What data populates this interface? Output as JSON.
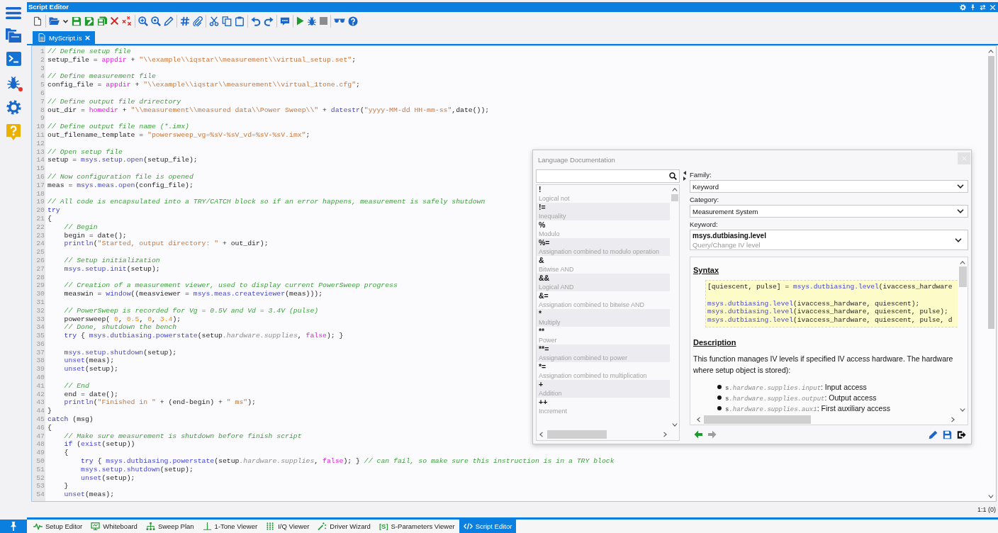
{
  "sidebar": [
    {
      "kind": "menu",
      "alert": false
    },
    {
      "kind": "folders",
      "alert": false
    },
    {
      "kind": "terminal",
      "alert": false
    },
    {
      "kind": "debug",
      "alert": true
    },
    {
      "kind": "settings",
      "alert": false
    },
    {
      "kind": "help",
      "alert": false
    }
  ],
  "window": {
    "title": "Script Editor",
    "controls": [
      {
        "kind": "settings"
      },
      {
        "kind": "pin"
      },
      {
        "kind": "swap"
      },
      {
        "kind": "close"
      }
    ]
  },
  "toolbar": [
    {
      "kind": "new"
    },
    {
      "kind": "separator"
    },
    {
      "kind": "open"
    },
    {
      "kind": "dropdown"
    },
    {
      "kind": "save"
    },
    {
      "kind": "save_as"
    },
    {
      "kind": "save_all"
    },
    {
      "kind": "delete"
    },
    {
      "kind": "delete_all"
    },
    {
      "kind": "separator"
    },
    {
      "kind": "zoom_in"
    },
    {
      "kind": "zoom_fit"
    },
    {
      "kind": "edit"
    },
    {
      "kind": "separator"
    },
    {
      "kind": "hash"
    },
    {
      "kind": "attach"
    },
    {
      "kind": "separator"
    },
    {
      "kind": "cut"
    },
    {
      "kind": "copy"
    },
    {
      "kind": "paste"
    },
    {
      "kind": "separator"
    },
    {
      "kind": "undo"
    },
    {
      "kind": "redo"
    },
    {
      "kind": "separator"
    },
    {
      "kind": "comment"
    },
    {
      "kind": "separator"
    },
    {
      "kind": "run"
    },
    {
      "kind": "debug"
    },
    {
      "kind": "stop"
    },
    {
      "kind": "separator"
    },
    {
      "kind": "glasses"
    },
    {
      "kind": "help"
    }
  ],
  "tabs": [
    {
      "label": "MyScript.is",
      "selected": true
    }
  ],
  "editor": {
    "lines": [
      {
        "number": "1",
        "tokens": [
          {
            "kind": "comment",
            "text": "// Define setup file"
          }
        ]
      },
      {
        "number": "2",
        "tokens": [
          {
            "kind": "plain",
            "text": "setup_file = "
          },
          {
            "kind": "builtin",
            "text": "appdir"
          },
          {
            "kind": "plain",
            "text": " + "
          },
          {
            "kind": "string",
            "text": "\"\\\\example\\\\iqstar\\\\measurement\\\\virtual_setup.set\""
          },
          {
            "kind": "plain",
            "text": ";"
          }
        ]
      },
      {
        "number": "3"
      },
      {
        "number": "4",
        "tokens": [
          {
            "kind": "comment",
            "text": "// Define measurement file"
          }
        ]
      },
      {
        "number": "5",
        "tokens": [
          {
            "kind": "plain",
            "text": "config_file = "
          },
          {
            "kind": "builtin",
            "text": "appdir"
          },
          {
            "kind": "plain",
            "text": " + "
          },
          {
            "kind": "string",
            "text": "\"\\\\example\\\\iqstar\\\\measurement\\\\virtual_1tone.cfg\""
          },
          {
            "kind": "plain",
            "text": ";"
          }
        ]
      },
      {
        "number": "6"
      },
      {
        "number": "7",
        "tokens": [
          {
            "kind": "comment",
            "text": "// Define output file drirectory"
          }
        ]
      },
      {
        "number": "8",
        "tokens": [
          {
            "kind": "plain",
            "text": "out_dir = "
          },
          {
            "kind": "builtin",
            "text": "homedir"
          },
          {
            "kind": "plain",
            "text": " + "
          },
          {
            "kind": "string",
            "text": "\"\\\\measurement\\\\measured data\\\\Power Sweep\\\\\""
          },
          {
            "kind": "plain",
            "text": " + "
          },
          {
            "kind": "function",
            "text": "datestr"
          },
          {
            "kind": "plain",
            "text": "("
          },
          {
            "kind": "string",
            "text": "\"yyyy-MM-dd HH-mm-ss\""
          },
          {
            "kind": "plain",
            "text": ",date());"
          }
        ]
      },
      {
        "number": "9"
      },
      {
        "number": "10",
        "tokens": [
          {
            "kind": "comment",
            "text": "// Define output file name (*.imx)"
          }
        ]
      },
      {
        "number": "11",
        "tokens": [
          {
            "kind": "plain",
            "text": "out_filename_template = "
          },
          {
            "kind": "string",
            "text": "\"powersweep_vg=%sV-%sV_vd=%sV-%sV.imx\""
          },
          {
            "kind": "plain",
            "text": ";"
          }
        ]
      },
      {
        "number": "12"
      },
      {
        "number": "13",
        "tokens": [
          {
            "kind": "comment",
            "text": "// Open setup file"
          }
        ]
      },
      {
        "number": "14",
        "tokens": [
          {
            "kind": "plain",
            "text": "setup = "
          },
          {
            "kind": "function",
            "text": "msys.setup.open"
          },
          {
            "kind": "plain",
            "text": "(setup_file);"
          }
        ]
      },
      {
        "number": "15"
      },
      {
        "number": "16",
        "tokens": [
          {
            "kind": "comment",
            "text": "// Now configuration file is opened"
          }
        ]
      },
      {
        "number": "17",
        "tokens": [
          {
            "kind": "plain",
            "text": "meas = "
          },
          {
            "kind": "function",
            "text": "msys.meas.open"
          },
          {
            "kind": "plain",
            "text": "(config_file);"
          }
        ]
      },
      {
        "number": "18"
      },
      {
        "number": "19",
        "tokens": [
          {
            "kind": "comment",
            "text": "// All code is encapsulated into a TRY/CATCH block so if an error happens, measurement is safely shutdown"
          }
        ]
      },
      {
        "number": "20",
        "tokens": [
          {
            "kind": "keyword",
            "text": "try"
          }
        ]
      },
      {
        "number": "21",
        "tokens": [
          {
            "kind": "plain",
            "text": "{"
          }
        ]
      },
      {
        "number": "22",
        "tokens": [
          {
            "kind": "comment",
            "text": "    // Begin"
          }
        ]
      },
      {
        "number": "23",
        "tokens": [
          {
            "kind": "plain",
            "text": "    begin = date();"
          }
        ]
      },
      {
        "number": "24",
        "tokens": [
          {
            "kind": "function",
            "text": "    println"
          },
          {
            "kind": "plain",
            "text": "("
          },
          {
            "kind": "string",
            "text": "\"Started, output directory: \""
          },
          {
            "kind": "plain",
            "text": " + out_dir);"
          }
        ]
      },
      {
        "number": "25"
      },
      {
        "number": "26",
        "tokens": [
          {
            "kind": "comment",
            "text": "    // Setup initialization"
          }
        ]
      },
      {
        "number": "27",
        "tokens": [
          {
            "kind": "function",
            "text": "    msys.setup.init"
          },
          {
            "kind": "plain",
            "text": "(setup);"
          }
        ]
      },
      {
        "number": "28"
      },
      {
        "number": "29",
        "tokens": [
          {
            "kind": "comment",
            "text": "    // Creation of a measurement viewer, used to display current PowerSweep progress"
          }
        ]
      },
      {
        "number": "30",
        "tokens": [
          {
            "kind": "plain",
            "text": "    measwin = "
          },
          {
            "kind": "function",
            "text": "window"
          },
          {
            "kind": "plain",
            "text": "((measviewer = "
          },
          {
            "kind": "function",
            "text": "msys.meas.createviewer"
          },
          {
            "kind": "plain",
            "text": "(meas)));"
          }
        ]
      },
      {
        "number": "31"
      },
      {
        "number": "32",
        "tokens": [
          {
            "kind": "comment",
            "text": "    // PowerSweep is recorded for Vg = 0.5V and Vd = 3.4V (pulse)"
          }
        ]
      },
      {
        "number": "33",
        "tokens": [
          {
            "kind": "plain",
            "text": "    powersweep( "
          },
          {
            "kind": "number",
            "text": "0"
          },
          {
            "kind": "plain",
            "text": ", "
          },
          {
            "kind": "number",
            "text": "0.5"
          },
          {
            "kind": "plain",
            "text": ", "
          },
          {
            "kind": "number",
            "text": "0"
          },
          {
            "kind": "plain",
            "text": ", "
          },
          {
            "kind": "number",
            "text": "3.4"
          },
          {
            "kind": "plain",
            "text": ");"
          }
        ]
      },
      {
        "number": "34",
        "tokens": [
          {
            "kind": "comment",
            "text": "    // Done, shutdown the bench"
          }
        ]
      },
      {
        "number": "35",
        "tokens": [
          {
            "kind": "keyword",
            "text": "    try"
          },
          {
            "kind": "plain",
            "text": " { "
          },
          {
            "kind": "function",
            "text": "msys.dutbiasing.powerstate"
          },
          {
            "kind": "plain",
            "text": "(setup"
          },
          {
            "kind": "member",
            "text": ".hardware.supplies"
          },
          {
            "kind": "plain",
            "text": ", "
          },
          {
            "kind": "builtin",
            "text": "false"
          },
          {
            "kind": "plain",
            "text": "); }"
          }
        ]
      },
      {
        "number": "36"
      },
      {
        "number": "37",
        "tokens": [
          {
            "kind": "function",
            "text": "    msys.setup.shutdown"
          },
          {
            "kind": "plain",
            "text": "(setup);"
          }
        ]
      },
      {
        "number": "38",
        "tokens": [
          {
            "kind": "function",
            "text": "    unset"
          },
          {
            "kind": "plain",
            "text": "(meas);"
          }
        ]
      },
      {
        "number": "39",
        "tokens": [
          {
            "kind": "function",
            "text": "    unset"
          },
          {
            "kind": "plain",
            "text": "(setup);"
          }
        ]
      },
      {
        "number": "40"
      },
      {
        "number": "41",
        "tokens": [
          {
            "kind": "comment",
            "text": "    // End"
          }
        ]
      },
      {
        "number": "42",
        "tokens": [
          {
            "kind": "plain",
            "text": "    end = date();"
          }
        ]
      },
      {
        "number": "43",
        "tokens": [
          {
            "kind": "function",
            "text": "    println"
          },
          {
            "kind": "plain",
            "text": "("
          },
          {
            "kind": "string",
            "text": "\"Finished in \""
          },
          {
            "kind": "plain",
            "text": " + (end-begin) + "
          },
          {
            "kind": "string",
            "text": "\" ms\""
          },
          {
            "kind": "plain",
            "text": ");"
          }
        ]
      },
      {
        "number": "44",
        "tokens": [
          {
            "kind": "plain",
            "text": "}"
          }
        ]
      },
      {
        "number": "45",
        "tokens": [
          {
            "kind": "keyword",
            "text": "catch"
          },
          {
            "kind": "plain",
            "text": " (msg)"
          }
        ]
      },
      {
        "number": "46",
        "tokens": [
          {
            "kind": "plain",
            "text": "{"
          }
        ]
      },
      {
        "number": "47",
        "tokens": [
          {
            "kind": "comment",
            "text": "    // Make sure measurement is shutdown before finish script"
          }
        ]
      },
      {
        "number": "48",
        "tokens": [
          {
            "kind": "keyword",
            "text": "    if"
          },
          {
            "kind": "plain",
            "text": " ("
          },
          {
            "kind": "function",
            "text": "exist"
          },
          {
            "kind": "plain",
            "text": "(setup))"
          }
        ]
      },
      {
        "number": "49",
        "tokens": [
          {
            "kind": "plain",
            "text": "    {"
          }
        ]
      },
      {
        "number": "50",
        "tokens": [
          {
            "kind": "keyword",
            "text": "        try"
          },
          {
            "kind": "plain",
            "text": " { "
          },
          {
            "kind": "function",
            "text": "msys.dutbiasing.powerstate"
          },
          {
            "kind": "plain",
            "text": "(setup"
          },
          {
            "kind": "member",
            "text": ".hardware.supplies"
          },
          {
            "kind": "plain",
            "text": ", "
          },
          {
            "kind": "builtin",
            "text": "false"
          },
          {
            "kind": "plain",
            "text": "); } "
          },
          {
            "kind": "comment",
            "text": "// can fail, so make sure this instruction is in a TRY block"
          }
        ]
      },
      {
        "number": "51",
        "tokens": [
          {
            "kind": "function",
            "text": "        msys.setup.shutdown"
          },
          {
            "kind": "plain",
            "text": "(setup);"
          }
        ]
      },
      {
        "number": "52",
        "tokens": [
          {
            "kind": "function",
            "text": "        unset"
          },
          {
            "kind": "plain",
            "text": "(setup);"
          }
        ]
      },
      {
        "number": "53",
        "tokens": [
          {
            "kind": "plain",
            "text": "    }"
          }
        ]
      },
      {
        "number": "54",
        "tokens": [
          {
            "kind": "function",
            "text": "    unset"
          },
          {
            "kind": "plain",
            "text": "(meas);"
          }
        ]
      }
    ]
  },
  "documentation": {
    "title": "Language Documentation",
    "entries": [
      {
        "symbol": "!",
        "description": "Logical not"
      },
      {
        "symbol": "!=",
        "description": "Inequality"
      },
      {
        "symbol": "%",
        "description": "Modulo"
      },
      {
        "symbol": "%=",
        "description": "Assignation combined to modulo operation"
      },
      {
        "symbol": "&",
        "description": "Bitwise AND"
      },
      {
        "symbol": "&&",
        "description": "Logical AND"
      },
      {
        "symbol": "&=",
        "description": "Assignation combined to bitwise AND"
      },
      {
        "symbol": "*",
        "description": "Multiply"
      },
      {
        "symbol": "**",
        "description": "Power"
      },
      {
        "symbol": "**=",
        "description": "Assignation combined to power"
      },
      {
        "symbol": "*=",
        "description": "Assignation combined to multiplication"
      },
      {
        "symbol": "+",
        "description": "Addition"
      },
      {
        "symbol": "++",
        "description": "Increment"
      }
    ],
    "fields": [
      {
        "label": "Family:",
        "value": "Keyword"
      },
      {
        "label": "Category:",
        "value": "Measurement System"
      }
    ],
    "keyword": {
      "label": "Keyword:",
      "name": "msys.dutbiasing.level",
      "summary": "Query/Change IV level"
    },
    "syntax": {
      "heading": "Syntax",
      "lines": [
        {
          "kind": "code",
          "tokens": [
            {
              "kind": "plain",
              "text": "[quiescent, pulse] = "
            },
            {
              "kind": "function",
              "text": "msys.dutbiasing.level"
            },
            {
              "kind": "plain",
              "text": "(ivaccess_hardware"
            }
          ]
        },
        {
          "kind": "blank"
        },
        {
          "kind": "code",
          "tokens": [
            {
              "kind": "function",
              "text": "msys.dutbiasing.level"
            },
            {
              "kind": "plain",
              "text": "(ivaccess_hardware, quiescent);"
            }
          ]
        },
        {
          "kind": "code",
          "tokens": [
            {
              "kind": "function",
              "text": "msys.dutbiasing.level"
            },
            {
              "kind": "plain",
              "text": "(ivaccess_hardware, quiescent, pulse);"
            }
          ]
        },
        {
          "kind": "code",
          "tokens": [
            {
              "kind": "function",
              "text": "msys.dutbiasing.level"
            },
            {
              "kind": "plain",
              "text": "(ivaccess_hardware, quiescent, pulse, d"
            }
          ]
        }
      ]
    },
    "description": {
      "heading": "Description",
      "text": "This function manages IV levels if specified IV access hardware. The hardware where setup object is stored):",
      "bullets": [
        {
          "object": "s",
          "member": ".hardware.supplies.input",
          "text": ": Input access"
        },
        {
          "object": "s",
          "member": ".hardware.supplies.output",
          "text": ": Output access"
        },
        {
          "object": "s",
          "member": ".hardware.supplies.aux1",
          "text": ": First auxiliary access"
        }
      ]
    },
    "navigation": [
      {
        "kind": "back",
        "disabled": false
      },
      {
        "kind": "forward",
        "disabled": true
      }
    ],
    "actions": [
      {
        "kind": "edit"
      },
      {
        "kind": "save"
      },
      {
        "kind": "exit"
      }
    ]
  },
  "status_bar": {
    "position": "1:1 (0)"
  },
  "taskbar": [
    {
      "kind": "pulse",
      "label": "Setup Editor",
      "selected": false
    },
    {
      "kind": "monitor",
      "label": "Whiteboard",
      "selected": false
    },
    {
      "kind": "hierarchy",
      "label": "Sweep Plan",
      "selected": false
    },
    {
      "kind": "tone",
      "label": "1-Tone Viewer",
      "selected": false
    },
    {
      "kind": "dots",
      "label": "I/Q Viewer",
      "selected": false
    },
    {
      "kind": "wand",
      "label": "Driver Wizard",
      "selected": false
    },
    {
      "kind": "text",
      "icon_text": "[S]",
      "label": "S-Parameters Viewer",
      "selected": false
    },
    {
      "kind": "code",
      "label": "Script Editor",
      "selected": true
    }
  ]
}
